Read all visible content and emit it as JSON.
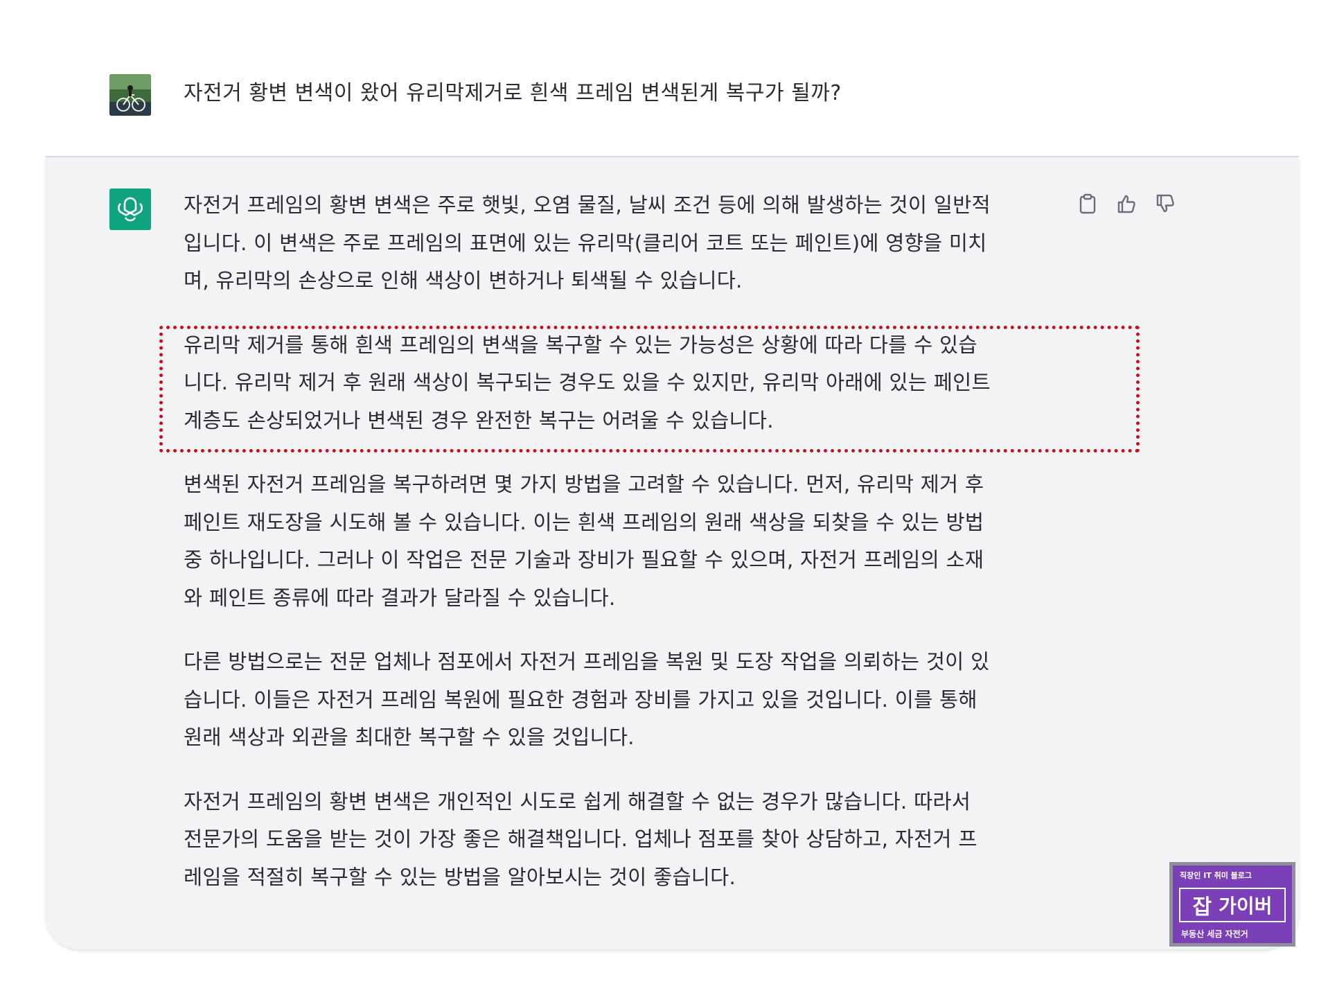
{
  "user": {
    "message": "자전거 황변 변색이 왔어 유리막제거로 흰색 프레임 변색된게 복구가 될까?"
  },
  "assistant": {
    "paragraphs": [
      [
        "자전거 프레임의 황변 변색은 주로 햇빛, 오염 물질, 날씨 조건 등에 의해 발생하는 것이 일반적",
        "입니다. 이 변색은 주로 프레임의 표면에 있는 유리막(클리어 코트 또는 페인트)에 영향을 미치",
        "며, 유리막의 손상으로 인해 색상이 변하거나 퇴색될 수 있습니다."
      ],
      [
        "유리막 제거를 통해 흰색 프레임의 변색을 복구할 수 있는 가능성은 상황에 따라 다를 수 있습",
        "니다. 유리막 제거 후 원래 색상이 복구되는 경우도 있을 수 있지만, 유리막 아래에 있는 페인트",
        "계층도 손상되었거나 변색된 경우 완전한 복구는 어려울 수 있습니다."
      ],
      [
        "변색된 자전거 프레임을 복구하려면 몇 가지 방법을 고려할 수 있습니다. 먼저, 유리막 제거 후",
        "페인트 재도장을 시도해 볼 수 있습니다. 이는 흰색 프레임의 원래 색상을 되찾을 수 있는 방법",
        "중 하나입니다. 그러나 이 작업은 전문 기술과 장비가 필요할 수 있으며, 자전거 프레임의 소재",
        "와 페인트 종류에 따라 결과가 달라질 수 있습니다."
      ],
      [
        "다른 방법으로는 전문 업체나 점포에서 자전거 프레임을 복원 및 도장 작업을 의뢰하는 것이 있",
        "습니다. 이들은 자전거 프레임 복원에 필요한 경험과 장비를 가지고 있을 것입니다. 이를 통해",
        "원래 색상과 외관을 최대한 복구할 수 있을 것입니다."
      ],
      [
        "자전거 프레임의 황변 변색은 개인적인 시도로 쉽게 해결할 수 없는 경우가 많습니다. 따라서",
        "전문가의 도움을 받는 것이 가장 좋은 해결책입니다. 업체나 점포를 찾아 상담하고, 자전거 프",
        "레임을 적절히 복구할 수 있는 방법을 알아보시는 것이 좋습니다."
      ]
    ]
  },
  "actions": [
    "copy-icon",
    "thumbs-up-icon",
    "thumbs-down-icon"
  ],
  "badge": {
    "top": "직장인 IT 취미 블로그",
    "char1": "잡",
    "name": "가이버",
    "bottom": "부동산 세금 자전거"
  },
  "colors": {
    "assistant_bg": "#f2f3f5",
    "gpt_green": "#10a37f",
    "highlight_red": "#c4101e",
    "badge_purple": "#7b3fb8"
  }
}
